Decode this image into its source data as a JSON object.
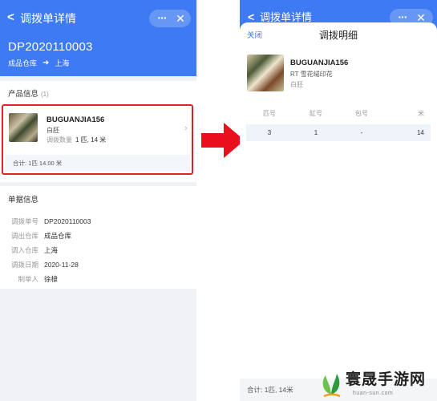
{
  "left": {
    "header": {
      "back_glyph": "<",
      "title": "调拨单详情",
      "more_glyph": "···",
      "close_glyph": "✕",
      "order_no": "DP2020110003",
      "route_from": "成品仓库",
      "route_arrow": "➜",
      "route_to": "上海"
    },
    "product_section": {
      "title": "产品信息",
      "count": "(1)",
      "item": {
        "code": "BUGUANJIA156",
        "color": "白胚",
        "qty_label": "调拨数量",
        "qty_value": "1 匹, 14 米",
        "chevron": "›",
        "total": "合计: 1匹 14.00 米"
      }
    },
    "doc_section": {
      "title": "单据信息",
      "rows": [
        {
          "key": "调拨单号",
          "value": "DP2020110003"
        },
        {
          "key": "调出仓库",
          "value": "成品仓库"
        },
        {
          "key": "调入仓库",
          "value": "上海"
        },
        {
          "key": "调拨日期",
          "value": "2020-11-28"
        },
        {
          "key": "制单人",
          "value": "徐棣"
        }
      ]
    }
  },
  "right": {
    "header": {
      "back_glyph": "<",
      "title": "调拨单详情",
      "more_glyph": "···",
      "close_glyph": "✕"
    },
    "sheet": {
      "close_label": "关闭",
      "title": "调拨明细",
      "product": {
        "code": "BUGUANJIA156",
        "name": "RT 雪花绒印花",
        "color": "白胚"
      },
      "table": {
        "headers": [
          "匹号",
          "缸号",
          "包号",
          "米"
        ],
        "rows": [
          [
            "3",
            "1",
            "-",
            "14"
          ]
        ]
      },
      "footer": "合计: 1匹, 14米"
    }
  },
  "colors": {
    "accent": "#3d7af3",
    "highlight": "#e0222a"
  },
  "watermark": {
    "name": "寰晟手游网",
    "url": "huan-sun.com"
  }
}
